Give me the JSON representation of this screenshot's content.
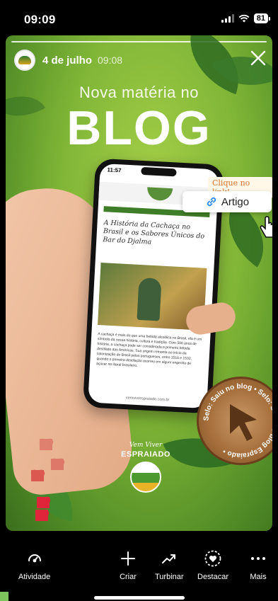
{
  "status_bar": {
    "time": "09:09",
    "battery": "81"
  },
  "story": {
    "date": "4 de julho",
    "time": "09:08",
    "headline_small": "Nova matéria no",
    "headline_big": "BLOG",
    "click_label": "Clique no link!",
    "link_label": "Artigo",
    "phone": {
      "time": "11:57",
      "article_title": "A História da Cachaça no Brasil e os Sabores Únicos do Bar do Djalma",
      "article_text": "A cachaça é mais do que uma bebida alcoólica no Brasil, ela é um símbolo da nossa história, cultura e tradição. Com 500 anos de história, a cachaça pode ser considerada o primeiro bebida destilado das Américas. Sua origem remonta ao início da colonização do Brasil pelos portugueses, entre 1516 e 1532, quando o primeiro destilação ocorreu em algum engenho de açúcar no litoral brasileiro.",
      "url": "vemvivrespraiado.com.br"
    },
    "stamp_text": "Selo: Saiu no blog • Selo: Saiu no blog Espraiado •",
    "logo": {
      "script": "Vem Viver",
      "name": "ESPRAIADO"
    }
  },
  "bottom_nav": [
    {
      "label": "Atividade",
      "icon": "activity-icon"
    },
    {
      "label": "Criar",
      "icon": "plus-icon"
    },
    {
      "label": "Turbinar",
      "icon": "trending-icon"
    },
    {
      "label": "Destacar",
      "icon": "highlight-heart-icon"
    },
    {
      "label": "Mais",
      "icon": "more-dots-icon"
    }
  ],
  "colors": {
    "accent_green": "#7fb536",
    "heart_red": "#e0243a",
    "click_orange": "#d8742a"
  }
}
